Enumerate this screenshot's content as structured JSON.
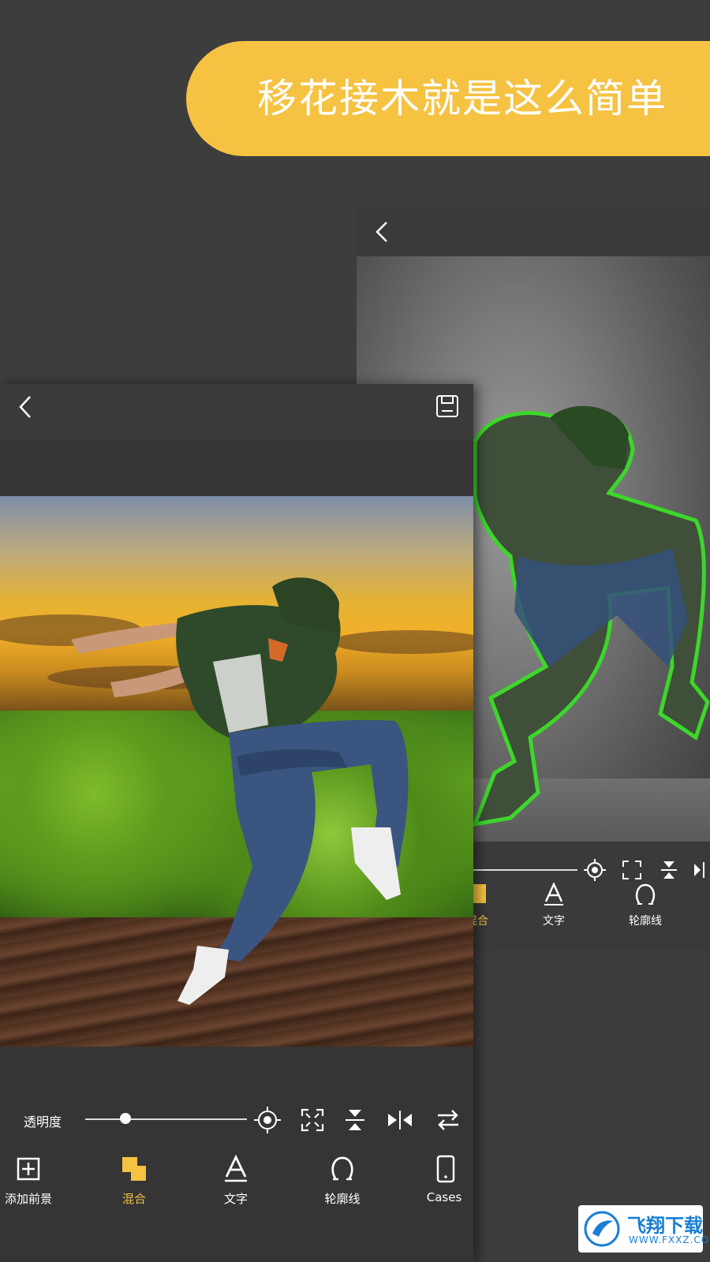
{
  "banner": {
    "title": "移花接木就是这么简单"
  },
  "back_screen": {
    "tabs": [
      {
        "label": "混合",
        "icon": "blend-icon"
      },
      {
        "label": "文字",
        "icon": "text-icon"
      },
      {
        "label": "轮廓线",
        "icon": "outline-icon"
      }
    ]
  },
  "front_screen": {
    "opacity_label": "透明度",
    "opacity_value": 0.25,
    "tabs": [
      {
        "label": "添加前景",
        "icon": "add-foreground-icon"
      },
      {
        "label": "混合",
        "icon": "blend-icon"
      },
      {
        "label": "文字",
        "icon": "text-icon"
      },
      {
        "label": "轮廓线",
        "icon": "outline-icon"
      },
      {
        "label": "Cases",
        "icon": "phone-icon"
      }
    ],
    "active_tab": "混合"
  },
  "colors": {
    "accent": "#f5c242",
    "outline": "#3dd62b",
    "toolbar": "#2f2f2f",
    "background": "#3d3d3d"
  },
  "watermark": {
    "title": "飞翔下载",
    "subtitle": "WWW.FXXZ.COM"
  }
}
